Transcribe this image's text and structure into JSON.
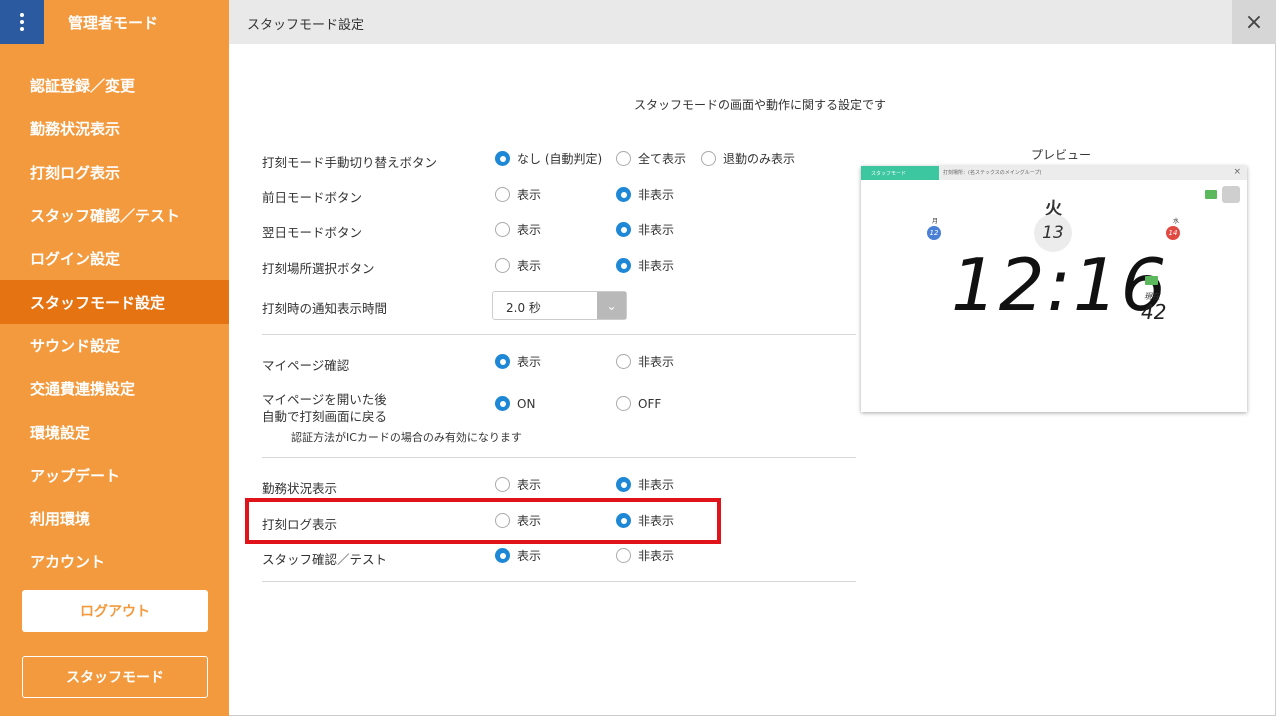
{
  "sidebar": {
    "title": "管理者モード",
    "items": [
      {
        "label": "認証登録／変更"
      },
      {
        "label": "勤務状況表示"
      },
      {
        "label": "打刻ログ表示"
      },
      {
        "label": "スタッフ確認／テスト"
      },
      {
        "label": "ログイン設定"
      },
      {
        "label": "スタッフモード設定",
        "active": true
      },
      {
        "label": "サウンド設定"
      },
      {
        "label": "交通費連携設定"
      },
      {
        "label": "環境設定"
      },
      {
        "label": "アップデート"
      },
      {
        "label": "利用環境"
      },
      {
        "label": "アカウント"
      }
    ],
    "logout_label": "ログアウト",
    "staff_mode_label": "スタッフモード"
  },
  "header": {
    "title": "スタッフモード設定",
    "close_icon": "×"
  },
  "main": {
    "subtitle": "スタッフモードの画面や動作に関する設定です",
    "settings": {
      "punch_toggle": {
        "label": "打刻モード手動切り替えボタン",
        "options": [
          "なし (自動判定)",
          "全て表示",
          "退勤のみ表示"
        ],
        "selected": 0
      },
      "prev_day": {
        "label": "前日モードボタン",
        "options": [
          "表示",
          "非表示"
        ],
        "selected": 1
      },
      "next_day": {
        "label": "翌日モードボタン",
        "options": [
          "表示",
          "非表示"
        ],
        "selected": 1
      },
      "place_select": {
        "label": "打刻場所選択ボタン",
        "options": [
          "表示",
          "非表示"
        ],
        "selected": 1
      },
      "notify_time": {
        "label": "打刻時の通知表示時間",
        "value": "2.0 秒"
      },
      "mypage_confirm": {
        "label": "マイページ確認",
        "options": [
          "表示",
          "非表示"
        ],
        "selected": 0
      },
      "mypage_return": {
        "label_line1": "マイページを開いた後",
        "label_line2": "自動で打刻画面に戻る",
        "options": [
          "ON",
          "OFF"
        ],
        "selected": 0,
        "note": "認証方法がICカードの場合のみ有効になります"
      },
      "work_status": {
        "label": "勤務状況表示",
        "options": [
          "表示",
          "非表示"
        ],
        "selected": 1
      },
      "punch_log": {
        "label": "打刻ログ表示",
        "options": [
          "表示",
          "非表示"
        ],
        "selected": 1
      },
      "staff_confirm": {
        "label": "スタッフ確認／テスト",
        "options": [
          "表示",
          "非表示"
        ],
        "selected": 0
      }
    }
  },
  "preview": {
    "label": "プレビュー",
    "tab_label": "スタッフモード",
    "info_text": "打刻場所：(名ステックスのメイングループ)",
    "day": "火",
    "date": "13",
    "prev_day": "月",
    "prev_date": "12",
    "next_day": "水",
    "next_date": "14",
    "time": "12:16",
    "now_label": "現在",
    "seconds": "42",
    "colors": {
      "tab": "#3dc7a0",
      "prev": "#4a7fd6",
      "next": "#e04a43"
    }
  },
  "colors": {
    "sidebar": "#f39a3e",
    "sidebar_active": "#e67312",
    "menu_button": "#2c5aa0",
    "radio_on": "#1e88d6",
    "highlight": "#e0121a"
  }
}
